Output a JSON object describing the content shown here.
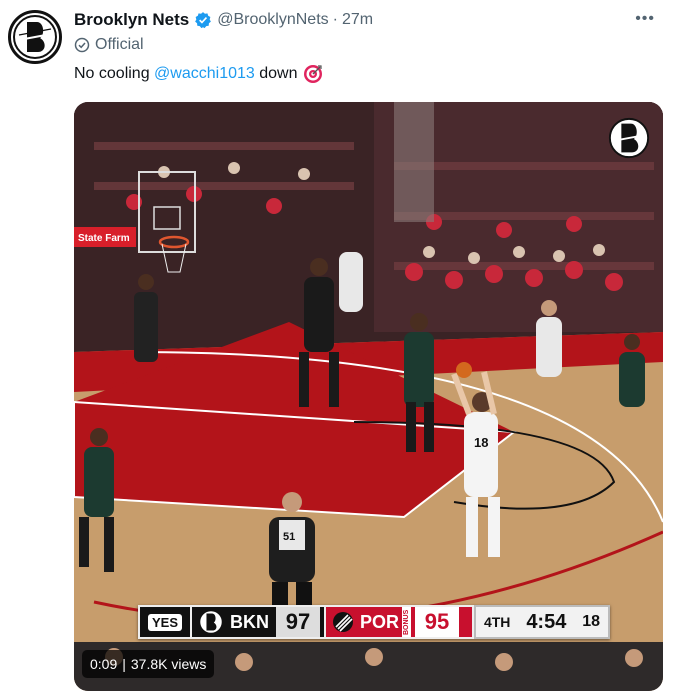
{
  "tweet": {
    "display_name": "Brooklyn Nets",
    "handle": "@BrooklynNets",
    "separator": "·",
    "time": "27m",
    "more_label": "•••",
    "official_label": "Official",
    "text_before": "No cooling ",
    "mention": "@wacchi1013",
    "text_after": " down",
    "emoji": "bullseye-icon"
  },
  "video": {
    "elapsed": "0:09",
    "views": "37.8K views",
    "scorebug": {
      "network": "YES",
      "home_abbr": "BKN",
      "home_score": "97",
      "away_abbr": "POR",
      "bonus": "BONUS",
      "away_score": "95",
      "period": "4TH",
      "clock": "4:54",
      "shot_clock": "18"
    },
    "player_number": "18",
    "referee_number": "51",
    "arena_sign": "State Farm"
  },
  "colors": {
    "verified_blue": "#1d9bf0",
    "mention_blue": "#1d9bf0",
    "blazers_red": "#c8102e",
    "court_red": "#b3141a"
  }
}
